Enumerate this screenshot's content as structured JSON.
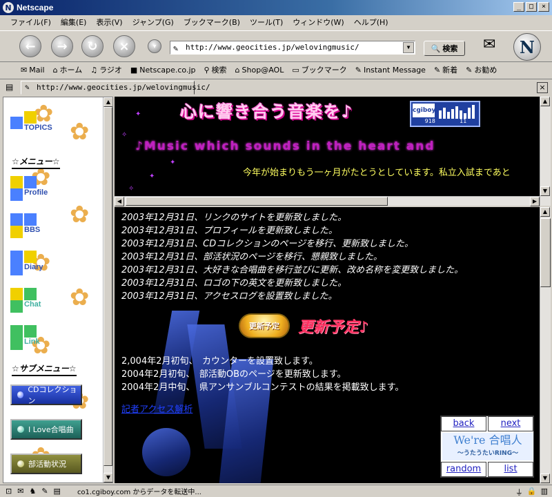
{
  "window": {
    "title": "Netscape",
    "min": "_",
    "max": "□",
    "close": "×"
  },
  "menu": [
    "ファイル(F)",
    "編集(E)",
    "表示(V)",
    "ジャンプ(G)",
    "ブックマーク(B)",
    "ツール(T)",
    "ウィンドウ(W)",
    "ヘルプ(H)"
  ],
  "nav": {
    "url": "http://www.geocities.jp/welovingmusic/",
    "search_label": "検索"
  },
  "personal_toolbar": [
    "Mail",
    "ホーム",
    "ラジオ",
    "Netscape.co.jp",
    "検索",
    "Shop@AOL",
    "ブックマーク",
    "Instant Message",
    "新着",
    "お勧め"
  ],
  "tab": {
    "url": "http://www.geocities.jp/welovingmusic/"
  },
  "sidebar": {
    "topics": "TOPICS",
    "menu_heading": "☆メニュー☆",
    "items": [
      "Profile",
      "BBS",
      "Diary",
      "Chat",
      "Link"
    ],
    "submenu_heading": "☆サブメニュー☆",
    "buttons": [
      "CDコレクション",
      "I Love合唱曲",
      "部活動状況"
    ]
  },
  "banner": {
    "title": "心に響き合う音楽を♪",
    "subtitle": "♪Music which sounds in   the heart and",
    "marquee": "今年が始まりもう一ヶ月がたとうとしています。私立入試まであと",
    "counter_brand": "cgiboy",
    "counter_left": "918",
    "counter_right": "11"
  },
  "news": {
    "lines": [
      "2003年12月31日、リンクのサイトを更新致しました。",
      "2003年12月31日、プロフィールを更新致しました。",
      "2003年12月31日、CDコレクションのページを移行、更新致しました。",
      "2003年12月31日、部活状況のページを移行、懇親致しました。",
      "2003年12月31日、大好きな合唱曲を移行並びに更新、改め名称を変更致しました。",
      "2003年12月31日、ロゴの下の英文を更新致しました。",
      "2003年12月31日、アクセスログを設置致しました。"
    ],
    "update_badge": "更新予定",
    "update_title": "更新予定♪",
    "planned": [
      "2,004年2月初旬、　カウンターを設置致します。",
      "2004年2月初旬、　部活動OBのページを更新致します。",
      "2004年2月中旬、　県アンサンブルコンテストの結果を掲載致します。"
    ],
    "access_link": "記者アクセス解析"
  },
  "webring": {
    "back": "back",
    "next": "next",
    "title": "We're 合唱人",
    "subtitle": "～うたうたいRING～",
    "random": "random",
    "list": "list"
  },
  "status": {
    "text": "co1.cgiboy.com からデータを転送中..."
  }
}
